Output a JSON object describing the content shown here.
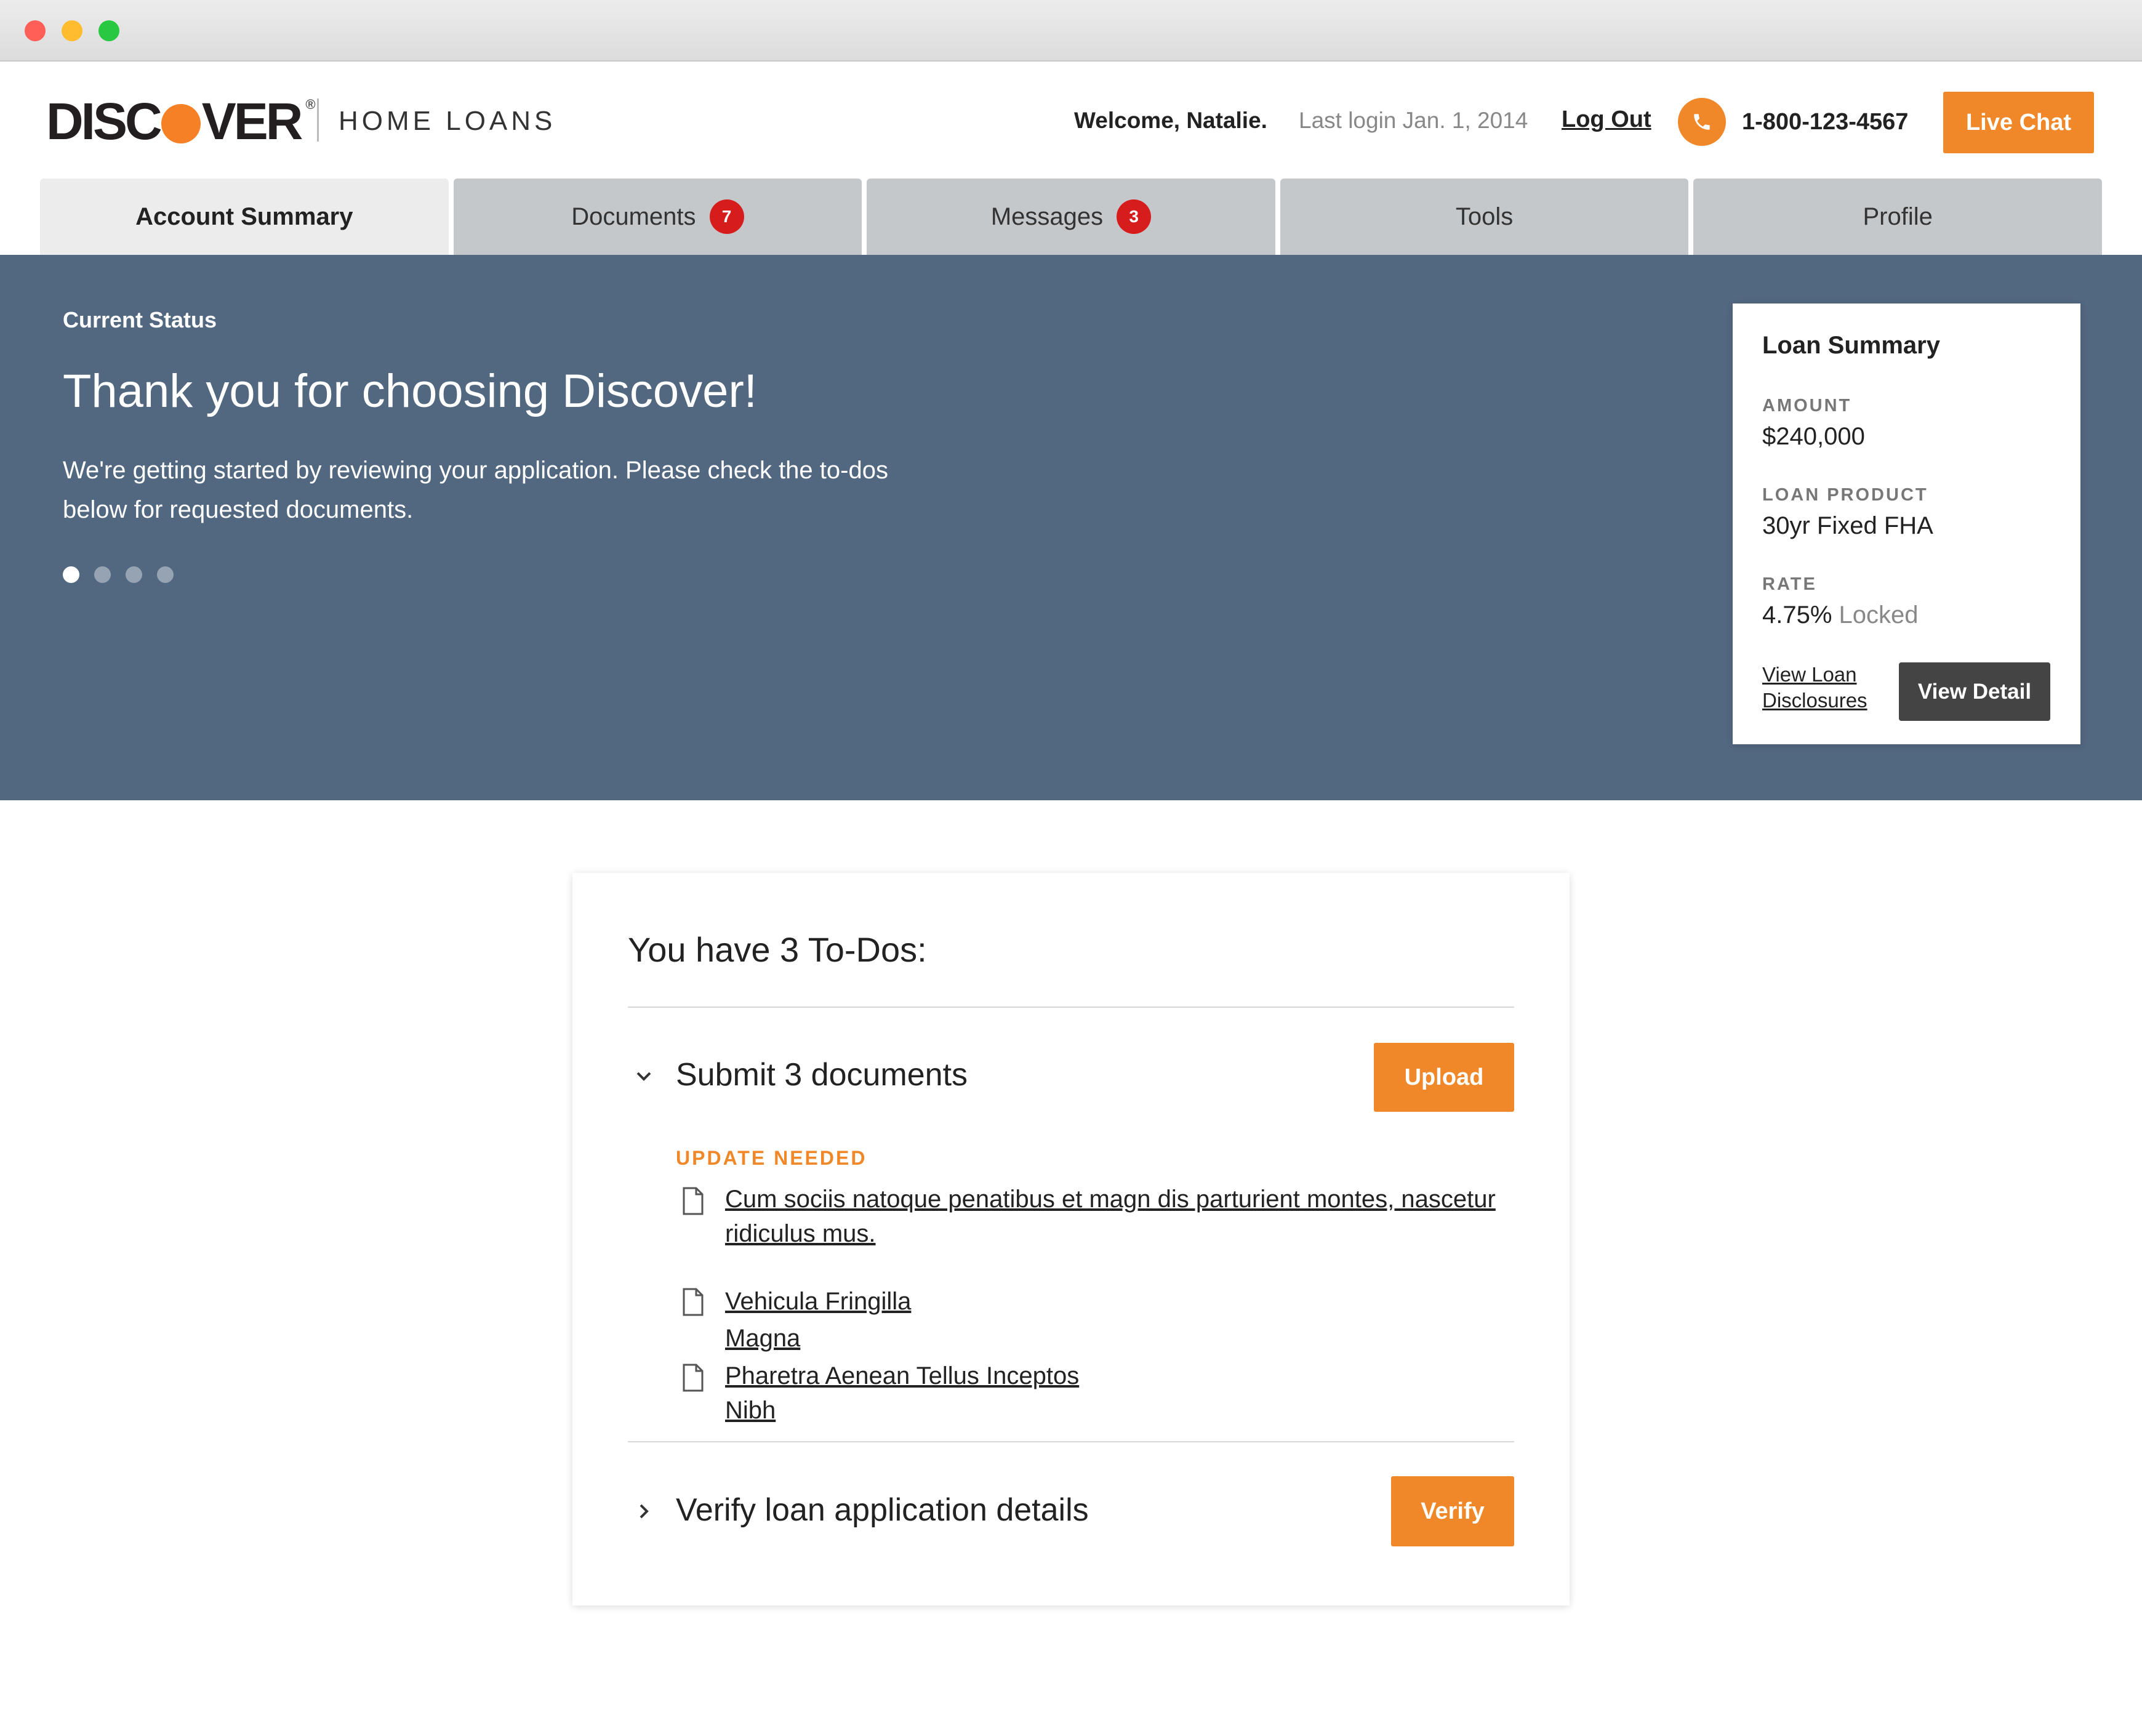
{
  "header": {
    "logo_text_left": "DISC",
    "logo_text_right": "VER",
    "logo_reg": "®",
    "brand_sub": "HOME LOANS",
    "welcome": "Welcome, Natalie.",
    "last_login": "Last login Jan. 1, 2014",
    "logout_label": "Log Out",
    "phone_number": "1-800-123-4567",
    "live_chat_label": "Live Chat",
    "phone_icon": "phone-icon"
  },
  "tabs": [
    {
      "label": "Account Summary",
      "badge": null,
      "active": true
    },
    {
      "label": "Documents",
      "badge": "7",
      "active": false
    },
    {
      "label": "Messages",
      "badge": "3",
      "active": false
    },
    {
      "label": "Tools",
      "badge": null,
      "active": false
    },
    {
      "label": "Profile",
      "badge": null,
      "active": false
    }
  ],
  "hero": {
    "label": "Current Status",
    "title": "Thank you for choosing Discover!",
    "text": "We're getting started by reviewing your application. Please check the to-dos below for requested documents.",
    "carousel_count": 4,
    "carousel_active": 1
  },
  "loan_summary": {
    "title": "Loan Summary",
    "amount_label": "AMOUNT",
    "amount_value": "$240,000",
    "product_label": "LOAN PRODUCT",
    "product_value": "30yr Fixed FHA",
    "rate_label": "RATE",
    "rate_value": "4.75%",
    "rate_status": "Locked",
    "disclosures_link": "View Loan Disclosures",
    "view_detail_label": "View Detail"
  },
  "todos": {
    "title": "You have 3 To-Dos:",
    "items": [
      {
        "title": "Submit 3 documents",
        "action_label": "Upload",
        "expanded": true,
        "status_label": "UPDATE NEEDED",
        "documents": [
          "Cum sociis natoque penatibus et magn dis parturient montes, nascetur ridiculus mus.",
          "Vehicula Fringilla Magna",
          "Pharetra Aenean Tellus Inceptos Nibh"
        ]
      },
      {
        "title": "Verify loan application details",
        "action_label": "Verify",
        "expanded": false
      }
    ]
  },
  "colors": {
    "brand_orange": "#f0882a",
    "hero_bg": "#526880",
    "badge_red": "#d71c1c"
  }
}
